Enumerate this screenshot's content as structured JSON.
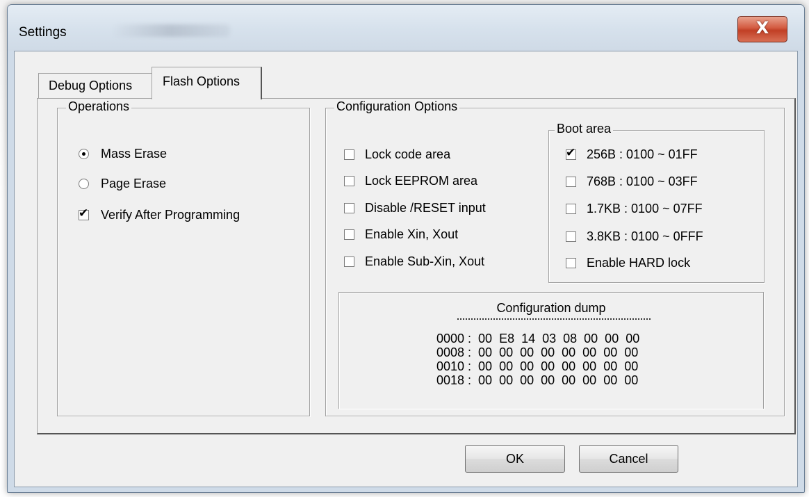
{
  "window": {
    "title": "Settings",
    "close_glyph": "X"
  },
  "tabs": [
    {
      "label": "Debug Options",
      "active": false
    },
    {
      "label": "Flash Options",
      "active": true
    }
  ],
  "operations": {
    "legend": "Operations",
    "items": [
      {
        "type": "radio",
        "label": "Mass Erase",
        "checked": true
      },
      {
        "type": "radio",
        "label": "Page Erase",
        "checked": false
      },
      {
        "type": "checkbox",
        "label": "Verify After Programming",
        "checked": true
      }
    ]
  },
  "config": {
    "legend": "Configuration Options",
    "items": [
      {
        "label": "Lock code area",
        "checked": false
      },
      {
        "label": "Lock EEPROM area",
        "checked": false
      },
      {
        "label": "Disable /RESET input",
        "checked": false
      },
      {
        "label": "Enable Xin, Xout",
        "checked": false
      },
      {
        "label": "Enable Sub-Xin, Xout",
        "checked": false
      }
    ]
  },
  "boot_area": {
    "legend": "Boot area",
    "items": [
      {
        "label": "256B : 0100 ~ 01FF",
        "checked": true
      },
      {
        "label": "768B : 0100 ~ 03FF",
        "checked": false
      },
      {
        "label": "1.7KB : 0100 ~ 07FF",
        "checked": false
      },
      {
        "label": "3.8KB : 0100 ~ 0FFF",
        "checked": false
      },
      {
        "label": "Enable HARD lock",
        "checked": false
      }
    ]
  },
  "dump": {
    "title": "Configuration dump",
    "lines": [
      "0000 :  00  E8  14  03  08  00  00  00",
      "0008 :  00  00  00  00  00  00  00  00",
      "0010 :  00  00  00  00  00  00  00  00",
      "0018 :  00  00  00  00  00  00  00  00"
    ]
  },
  "buttons": {
    "ok": "OK",
    "cancel": "Cancel"
  }
}
